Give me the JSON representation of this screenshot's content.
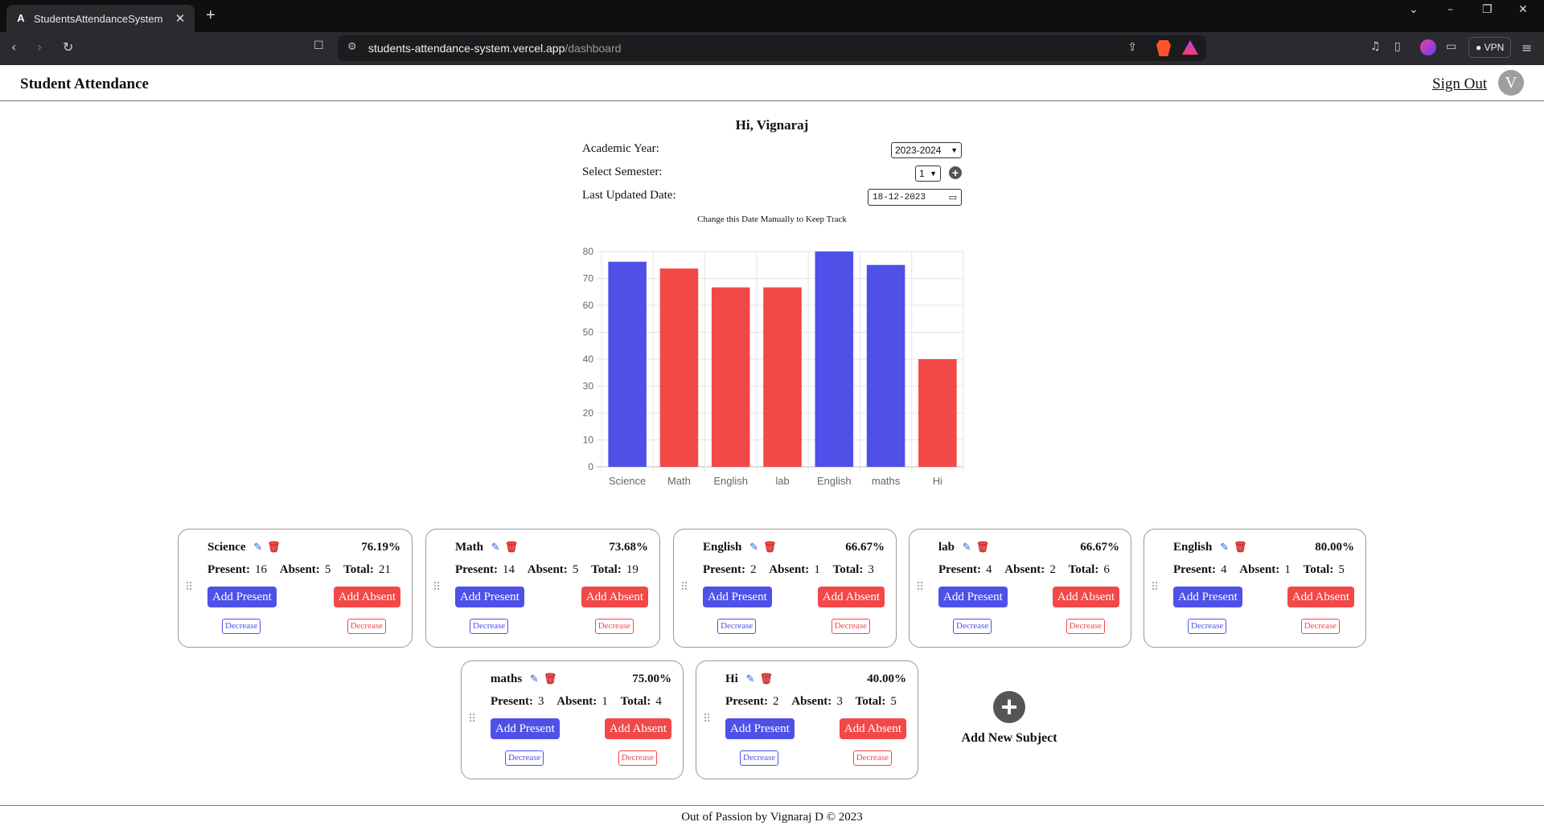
{
  "browser": {
    "tab_title": "StudentsAttendanceSystem",
    "tab_favicon": "A",
    "url_host": "students-attendance-system.vercel.app",
    "url_path": "/dashboard",
    "vpn_label": "VPN",
    "badge_count": "1"
  },
  "app": {
    "brand": "Student Attendance",
    "sign_out": "Sign Out",
    "avatar_initial": "V",
    "greeting": "Hi, Vignaraj"
  },
  "form": {
    "year_label": "Academic Year:",
    "year_value": "2023-2024",
    "semester_label": "Select Semester:",
    "semester_value": "1",
    "date_label": "Last Updated Date:",
    "date_value": "18-12-2023",
    "hint": "Change this Date Manually to Keep Track"
  },
  "colors": {
    "present": "#4f50e8",
    "absent": "#f24848"
  },
  "chart_data": {
    "type": "bar",
    "categories": [
      "Science",
      "Math",
      "English",
      "lab",
      "English",
      "maths",
      "Hi"
    ],
    "values": [
      76.19,
      73.68,
      66.67,
      66.67,
      80.0,
      75.0,
      40.0
    ],
    "bar_colors": [
      "#4f50e8",
      "#f24848",
      "#f24848",
      "#f24848",
      "#4f50e8",
      "#4f50e8",
      "#f24848"
    ],
    "ylim": [
      0,
      80
    ],
    "yticks": [
      0,
      10,
      20,
      30,
      40,
      50,
      60,
      70,
      80
    ],
    "grid": true,
    "title": "",
    "xlabel": "",
    "ylabel": ""
  },
  "labels": {
    "present": "Present:",
    "absent": "Absent:",
    "total": "Total:",
    "add_present": "Add Present",
    "add_absent": "Add Absent",
    "decrease": "Decrease",
    "add_new_subject": "Add New Subject"
  },
  "subjects": [
    {
      "name": "Science",
      "percent": "76.19%",
      "present": "16",
      "absent": "5",
      "total": "21"
    },
    {
      "name": "Math",
      "percent": "73.68%",
      "present": "14",
      "absent": "5",
      "total": "19"
    },
    {
      "name": "English",
      "percent": "66.67%",
      "present": "2",
      "absent": "1",
      "total": "3"
    },
    {
      "name": "lab",
      "percent": "66.67%",
      "present": "4",
      "absent": "2",
      "total": "6"
    },
    {
      "name": "English",
      "percent": "80.00%",
      "present": "4",
      "absent": "1",
      "total": "5"
    },
    {
      "name": "maths",
      "percent": "75.00%",
      "present": "3",
      "absent": "1",
      "total": "4"
    },
    {
      "name": "Hi",
      "percent": "40.00%",
      "present": "2",
      "absent": "3",
      "total": "5"
    }
  ],
  "footer": "Out of Passion by Vignaraj D © 2023"
}
